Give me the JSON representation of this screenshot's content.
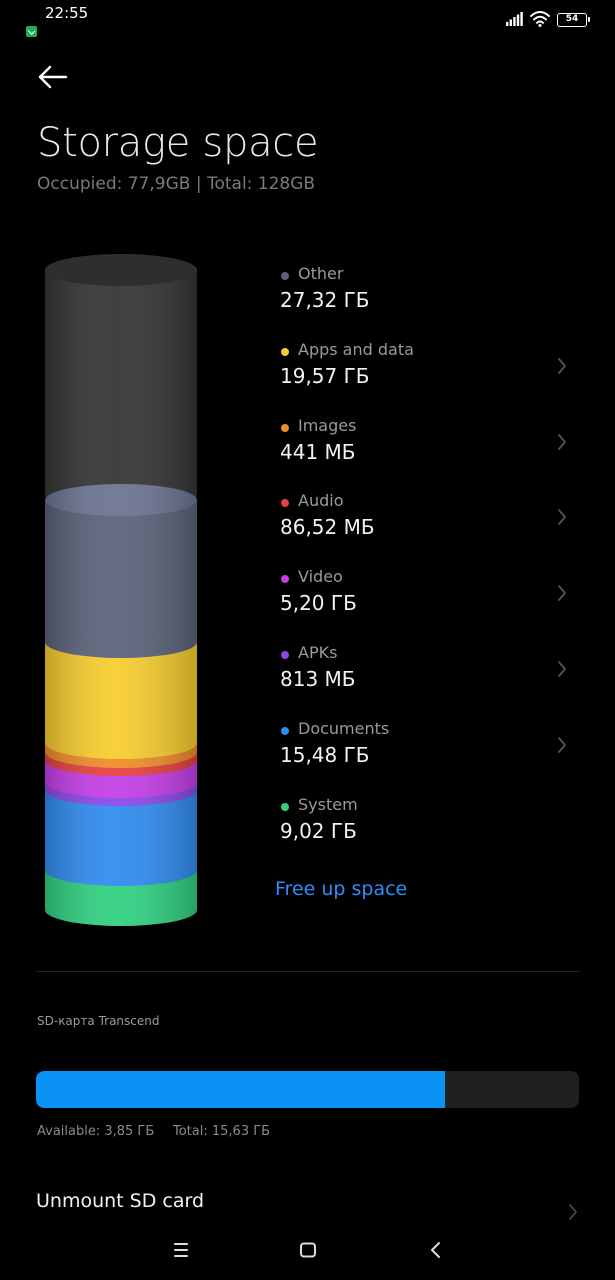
{
  "status_bar": {
    "time": "22:55",
    "battery": "54"
  },
  "header": {
    "title": "Storage space",
    "subtitle": "Occupied: 77,9GB | Total: 128GB"
  },
  "storage": {
    "items": [
      {
        "label": "Other",
        "value": "27,32 ГБ",
        "color": "#5a6279",
        "has_chevron": false
      },
      {
        "label": "Apps and data",
        "value": "19,57 ГБ",
        "color": "#f7cd2e",
        "has_chevron": true
      },
      {
        "label": "Images",
        "value": "441 МБ",
        "color": "#f08c2a",
        "has_chevron": true
      },
      {
        "label": "Audio",
        "value": "86,52 МБ",
        "color": "#e84040",
        "has_chevron": true
      },
      {
        "label": "Video",
        "value": "5,20 ГБ",
        "color": "#c53ee8",
        "has_chevron": true
      },
      {
        "label": "APKs",
        "value": "813 МБ",
        "color": "#8a48ea",
        "has_chevron": true
      },
      {
        "label": "Documents",
        "value": "15,48 ГБ",
        "color": "#2f8cf0",
        "has_chevron": true
      },
      {
        "label": "System",
        "value": "9,02 ГБ",
        "color": "#2fd081",
        "has_chevron": false
      }
    ],
    "free_up_label": "Free up space"
  },
  "sd_card": {
    "title": "SD-карта Transcend",
    "used_fraction": 0.754,
    "available": "Available: 3,85 ГБ",
    "total": "Total: 15,63 ГБ"
  },
  "unmount_label": "Unmount SD card",
  "colors": {
    "accent": "#2f8cff",
    "sd_fill": "#0a93f5",
    "free_space": "#343434"
  }
}
